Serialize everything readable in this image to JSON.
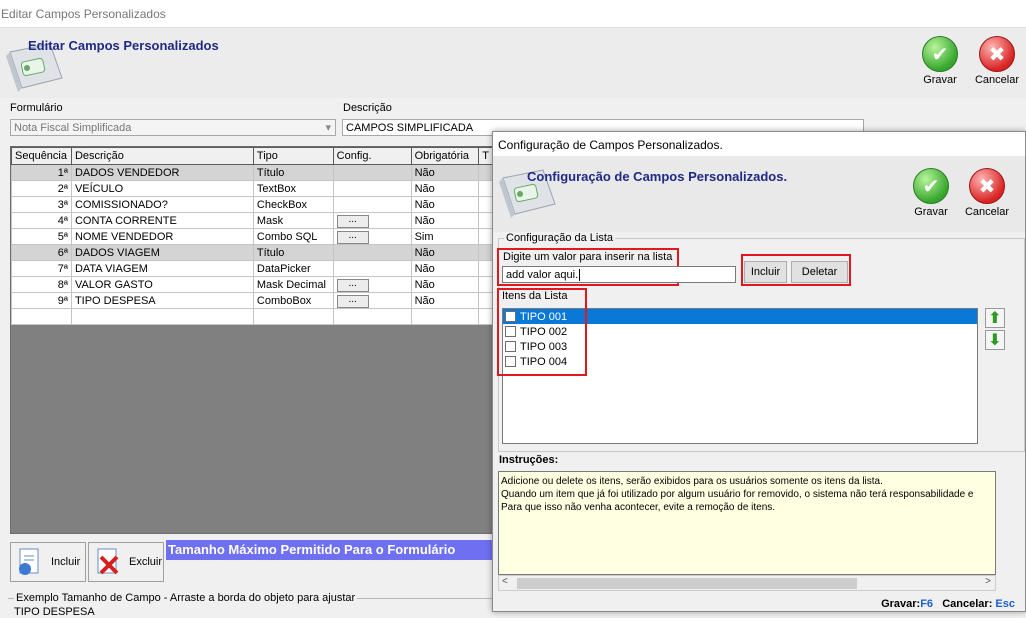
{
  "window": {
    "title": "Editar Campos Personalizados"
  },
  "header": {
    "title": "Editar Campos Personalizados",
    "save_label": "Gravar",
    "cancel_label": "Cancelar"
  },
  "form": {
    "formulario_label": "Formulário",
    "formulario_value": "Nota Fiscal Simplificada",
    "descricao_label": "Descrição",
    "descricao_value": "CAMPOS SIMPLIFICADA"
  },
  "grid": {
    "columns": [
      "Sequência",
      "Descrição",
      "Tipo",
      "Config.",
      "Obrigatória",
      "T"
    ],
    "rows": [
      {
        "seq": "1ª",
        "desc": "DADOS VENDEDOR",
        "tipo": "Título",
        "config": "",
        "obrig": "Não",
        "title": true
      },
      {
        "seq": "2ª",
        "desc": "VEÍCULO",
        "tipo": "TextBox",
        "config": "",
        "obrig": "Não",
        "title": false
      },
      {
        "seq": "3ª",
        "desc": "COMISSIONADO?",
        "tipo": "CheckBox",
        "config": "",
        "obrig": "Não",
        "title": false
      },
      {
        "seq": "4ª",
        "desc": "CONTA CORRENTE",
        "tipo": "Mask",
        "config": "...",
        "obrig": "Não",
        "title": false
      },
      {
        "seq": "5ª",
        "desc": "NOME VENDEDOR",
        "tipo": "Combo SQL",
        "config": "...",
        "obrig": "Sim",
        "title": false
      },
      {
        "seq": "6ª",
        "desc": "DADOS VIAGEM",
        "tipo": "Título",
        "config": "",
        "obrig": "Não",
        "title": true
      },
      {
        "seq": "7ª",
        "desc": "DATA VIAGEM",
        "tipo": "DataPicker",
        "config": "",
        "obrig": "Não",
        "title": false
      },
      {
        "seq": "8ª",
        "desc": "VALOR GASTO",
        "tipo": "Mask Decimal",
        "config": "...",
        "obrig": "Não",
        "title": false
      },
      {
        "seq": "9ª",
        "desc": "TIPO DESPESA",
        "tipo": "ComboBox",
        "config": "...",
        "obrig": "Não",
        "title": false
      }
    ]
  },
  "bottom": {
    "incluir_label": "Incluir",
    "excluir_label": "Excluir",
    "max_size_text": "Tamanho Máximo Permitido Para o Formulário",
    "example_legend": "Exemplo Tamanho de Campo - Arraste a borda do objeto para ajustar",
    "example_value": "TIPO DESPESA"
  },
  "dialog": {
    "title": "Configuração de Campos Personalizados.",
    "header_title": "Configuração de Campos Personalizados.",
    "save_label": "Gravar",
    "cancel_label": "Cancelar",
    "group_legend": "Configuração da Lista",
    "input_label": "Digite um valor para inserir na lista",
    "input_value": "add valor aqui.",
    "incluir_label": "Incluir",
    "deletar_label": "Deletar",
    "items_label": "Itens da Lista",
    "items": [
      "TIPO 001",
      "TIPO 002",
      "TIPO 003",
      "TIPO 004"
    ],
    "selected_index": 0,
    "instructions_label": "Instruções:",
    "instructions": [
      "Adicione ou delete os itens, serão exibidos para os usuários somente os itens da lista.",
      "Quando um item que já foi utilizado por algum usuário for removido, o sistema não terá responsabilidade e",
      "Para que isso não venha acontecer, evite a remoção de itens."
    ],
    "shortcut_save_label": "Gravar:",
    "shortcut_save_key": "F6",
    "shortcut_cancel_label": "Cancelar:",
    "shortcut_cancel_key": "Esc"
  }
}
